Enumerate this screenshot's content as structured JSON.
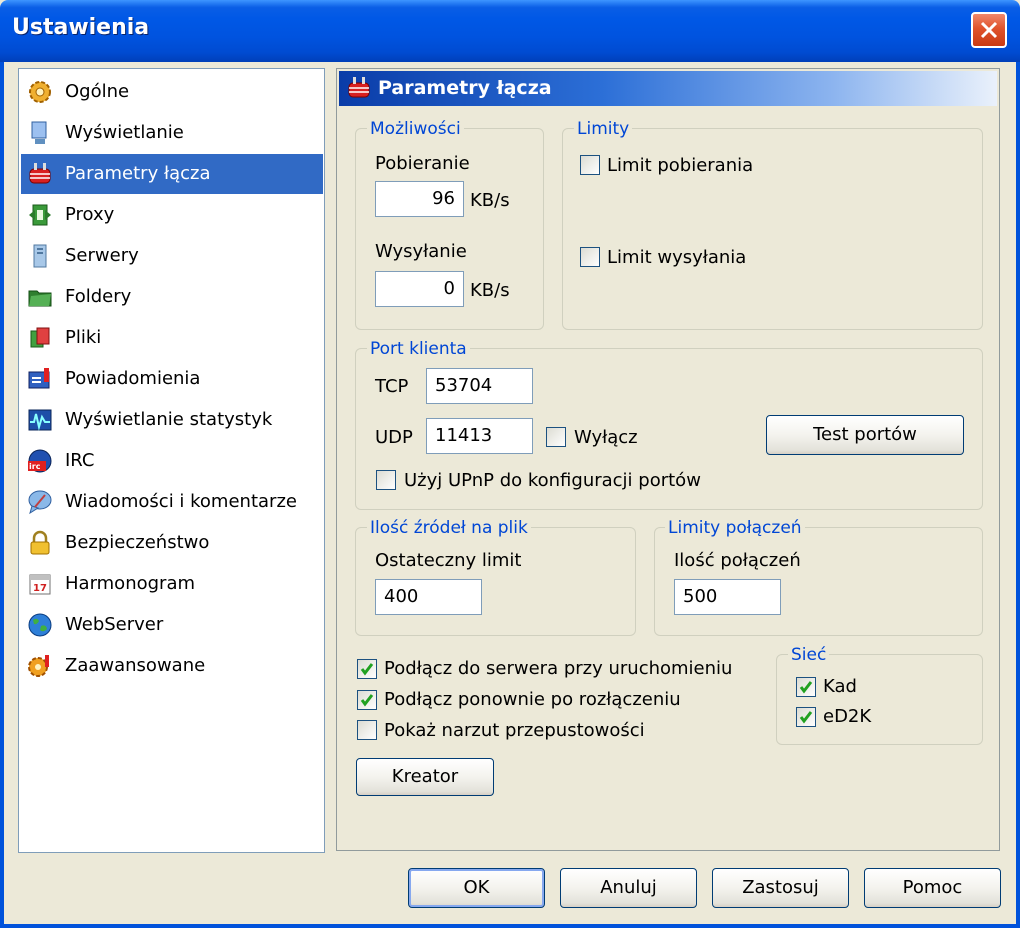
{
  "window": {
    "title": "Ustawienia"
  },
  "sidebar": {
    "items": [
      {
        "label": "Ogólne",
        "icon": "gear-icon"
      },
      {
        "label": "Wyświetlanie",
        "icon": "monitor-icon"
      },
      {
        "label": "Parametry łącza",
        "icon": "plug-icon",
        "selected": true
      },
      {
        "label": "Proxy",
        "icon": "proxy-icon"
      },
      {
        "label": "Serwery",
        "icon": "server-icon"
      },
      {
        "label": "Foldery",
        "icon": "folder-icon"
      },
      {
        "label": "Pliki",
        "icon": "files-icon"
      },
      {
        "label": "Powiadomienia",
        "icon": "notification-icon"
      },
      {
        "label": "Wyświetlanie statystyk",
        "icon": "statistics-icon"
      },
      {
        "label": "IRC",
        "icon": "irc-icon"
      },
      {
        "label": "Wiadomości i komentarze",
        "icon": "messages-icon"
      },
      {
        "label": "Bezpieczeństwo",
        "icon": "lock-icon"
      },
      {
        "label": "Harmonogram",
        "icon": "calendar-icon"
      },
      {
        "label": "WebServer",
        "icon": "globe-icon"
      },
      {
        "label": "Zaawansowane",
        "icon": "advanced-gear-icon"
      }
    ]
  },
  "panel": {
    "title": "Parametry łącza",
    "capabilities": {
      "legend": "Możliwości",
      "download_label": "Pobieranie",
      "download_value": "96",
      "upload_label": "Wysyłanie",
      "upload_value": "0",
      "unit": "KB/s"
    },
    "limits": {
      "legend": "Limity",
      "download_limit": {
        "label": "Limit pobierania",
        "checked": false
      },
      "upload_limit": {
        "label": "Limit wysyłania",
        "checked": false
      }
    },
    "client_port": {
      "legend": "Port klienta",
      "tcp_label": "TCP",
      "tcp_value": "53704",
      "udp_label": "UDP",
      "udp_value": "11413",
      "disable_label": "Wyłącz",
      "disable_checked": false,
      "test_button": "Test portów",
      "upnp_label": "Użyj UPnP do konfiguracji portów",
      "upnp_checked": false
    },
    "sources": {
      "legend": "Ilość źródeł na plik",
      "label": "Ostateczny limit",
      "value": "400"
    },
    "connections": {
      "legend": "Limity połączeń",
      "label": "Ilość połączeń",
      "value": "500"
    },
    "options": [
      {
        "label": "Podłącz do serwera przy uruchomieniu",
        "checked": true
      },
      {
        "label": "Podłącz ponownie po rozłączeniu",
        "checked": true
      },
      {
        "label": "Pokaż narzut przepustowości",
        "checked": false
      }
    ],
    "network": {
      "legend": "Sieć",
      "items": [
        {
          "label": "Kad",
          "checked": true
        },
        {
          "label": "eD2K",
          "checked": true
        }
      ]
    },
    "wizard_button": "Kreator"
  },
  "footer": {
    "ok": "OK",
    "cancel": "Anuluj",
    "apply": "Zastosuj",
    "help": "Pomoc"
  },
  "colors": {
    "titlebar": "#0054e3",
    "selection": "#316ac5",
    "legend_text": "#0046d5",
    "check": "#21a121"
  }
}
